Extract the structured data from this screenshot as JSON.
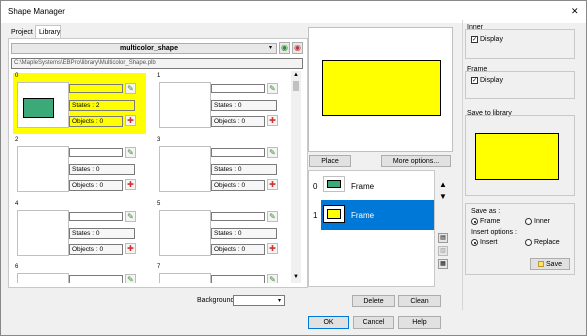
{
  "window": {
    "title": "Shape Manager",
    "close_glyph": "✕"
  },
  "tabs": [
    {
      "label": "Project"
    },
    {
      "label": "Library"
    }
  ],
  "library": {
    "name": "multicolor_shape",
    "path": "C:\\MapleSystems\\EBPro\\library\\Multicolor_Shape.plb"
  },
  "cells": [
    {
      "num": "0",
      "states": "States : 2",
      "objects": "Objects : 0",
      "selected": true,
      "shape_color": "#3caa78"
    },
    {
      "num": "1",
      "states": "States : 0",
      "objects": "Objects : 0"
    },
    {
      "num": "2",
      "states": "States : 0",
      "objects": "Objects : 0"
    },
    {
      "num": "3",
      "states": "States : 0",
      "objects": "Objects : 0"
    },
    {
      "num": "4",
      "states": "States : 0",
      "objects": "Objects : 0"
    },
    {
      "num": "5",
      "states": "States : 0",
      "objects": "Objects : 0"
    },
    {
      "num": "6"
    },
    {
      "num": "7"
    }
  ],
  "background_label": "Background :",
  "buttons": {
    "place": "Place",
    "more_options": "More options...",
    "delete": "Delete",
    "clean": "Clean",
    "ok": "OK",
    "cancel": "Cancel",
    "help": "Help",
    "save": "Save"
  },
  "state_list": [
    {
      "index": "0",
      "label": "Frame",
      "color": "#3caa78",
      "selected": false
    },
    {
      "index": "1",
      "label": "Frame",
      "color": "#ffff00",
      "selected": true
    }
  ],
  "inner": {
    "title": "Inner",
    "display": "Display",
    "checked": true
  },
  "frame": {
    "title": "Frame",
    "display": "Display",
    "checked": true
  },
  "save_to_library": {
    "title": "Save to library"
  },
  "save_as": {
    "label": "Save as :",
    "options": [
      "Frame",
      "Inner"
    ],
    "selected": "Frame"
  },
  "insert_options": {
    "label": "Insert options :",
    "options": [
      "Insert",
      "Replace"
    ],
    "selected": "Insert"
  },
  "colors": {
    "selection_blue": "#0078d7",
    "highlight_yellow": "#ffff00"
  }
}
